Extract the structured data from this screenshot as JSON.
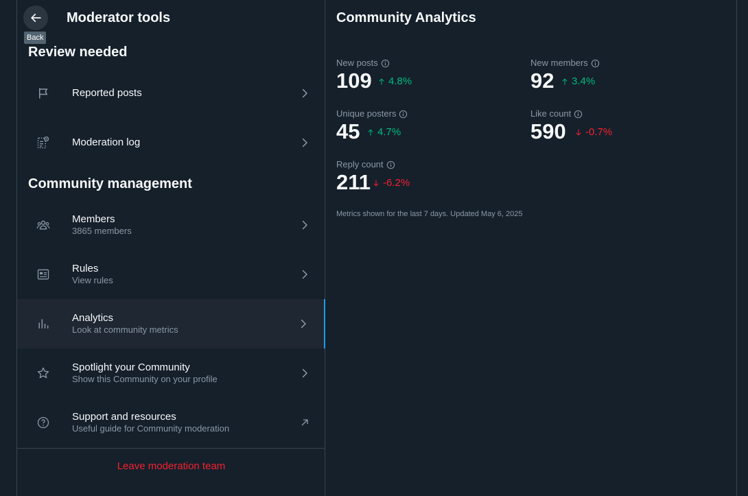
{
  "colors": {
    "background": "#15202b",
    "border": "#38444d",
    "text_primary": "#f7f9f9",
    "text_secondary": "#8b98a5",
    "accent": "#1d9bf0",
    "positive": "#00ba7c",
    "negative": "#f4212e"
  },
  "header": {
    "title": "Moderator tools",
    "back_tooltip": "Back",
    "back_icon": "arrow-left-icon"
  },
  "sections": {
    "review_needed": "Review needed",
    "community_management": "Community management"
  },
  "menu": [
    {
      "label": "Reported posts",
      "subtitle": "",
      "icon": "flag-icon",
      "trailing": "chevron-right-icon"
    },
    {
      "label": "Moderation log",
      "subtitle": "",
      "icon": "moderation-log-icon",
      "trailing": "chevron-right-icon"
    },
    {
      "label": "Members",
      "subtitle": "3865 members",
      "icon": "members-icon",
      "trailing": "chevron-right-icon"
    },
    {
      "label": "Rules",
      "subtitle": "View rules",
      "icon": "rules-icon",
      "trailing": "chevron-right-icon"
    },
    {
      "label": "Analytics",
      "subtitle": "Look at community metrics",
      "icon": "analytics-icon",
      "trailing": "chevron-right-icon",
      "active": true
    },
    {
      "label": "Spotlight your Community",
      "subtitle": "Show this Community on your profile",
      "icon": "star-icon",
      "trailing": "chevron-right-icon"
    },
    {
      "label": "Support and resources",
      "subtitle": "Useful guide for Community moderation",
      "icon": "help-icon",
      "trailing": "external-arrow-icon"
    }
  ],
  "leave_button": "Leave moderation team",
  "analytics": {
    "title": "Community Analytics",
    "metrics": [
      {
        "label": "New posts",
        "value": "109",
        "change": "4.8%",
        "direction": "up"
      },
      {
        "label": "New members",
        "value": "92",
        "change": "3.4%",
        "direction": "up"
      },
      {
        "label": "Unique posters",
        "value": "45",
        "change": "4.7%",
        "direction": "up"
      },
      {
        "label": "Like count",
        "value": "590",
        "change": "-0.7%",
        "direction": "down"
      },
      {
        "label": "Reply count",
        "value": "211",
        "change": "-6.2%",
        "direction": "down"
      }
    ],
    "footnote": "Metrics shown for the last 7 days. Updated May 6, 2025"
  }
}
